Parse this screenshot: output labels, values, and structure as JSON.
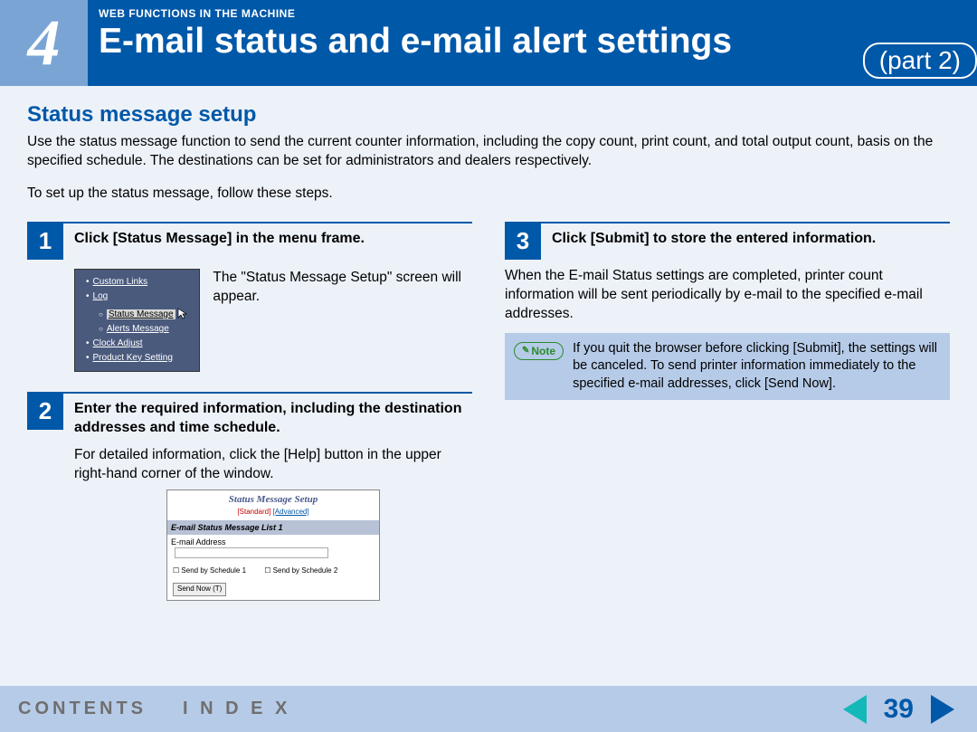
{
  "banner": {
    "chapter_number": "4",
    "breadcrumb": "WEB FUNCTIONS IN THE MACHINE",
    "title": "E-mail status and e-mail alert settings",
    "part": "(part 2)"
  },
  "section_title": "Status message setup",
  "intro": "Use the status message function to send the current counter information, including the copy count, print count, and total output count, basis on the specified schedule. The destinations can be set for administrators and dealers respectively.",
  "intro2": "To set up the status message, follow these steps.",
  "steps": {
    "s1": {
      "num": "1",
      "title": "Click [Status Message] in the menu frame.",
      "side_text": "The \"Status Message Setup\" screen will appear."
    },
    "s2": {
      "num": "2",
      "title": "Enter the required information, including the destination addresses and time schedule.",
      "body": "For detailed information, click the [Help] button in the upper right-hand corner of the window."
    },
    "s3": {
      "num": "3",
      "title": "Click [Submit] to store the entered information.",
      "body": "When the E-mail Status settings are completed, printer count information will be sent periodically by e-mail to the specified e-mail addresses."
    }
  },
  "menu_shot": {
    "custom_links": "Custom Links",
    "log": "Log",
    "status_message": "Status Message",
    "alerts_message": "Alerts Message",
    "clock_adjust": "Clock Adjust",
    "product_key": "Product Key Setting"
  },
  "form_shot": {
    "title": "Status Message Setup",
    "mode_std": "[Standard]",
    "mode_adv": "[Advanced]",
    "bar": "E-mail Status Message List 1",
    "label_addr": "E-mail Address",
    "sched1": "Send by Schedule 1",
    "sched2": "Send by Schedule 2",
    "btn": "Send Now (T)"
  },
  "note": {
    "label": "Note",
    "text": "If you quit the browser before clicking [Submit], the settings will be canceled. To send printer information immediately to the specified e-mail addresses, click [Send Now]."
  },
  "footer": {
    "contents": "CONTENTS",
    "index": "I N D E X",
    "page": "39"
  }
}
